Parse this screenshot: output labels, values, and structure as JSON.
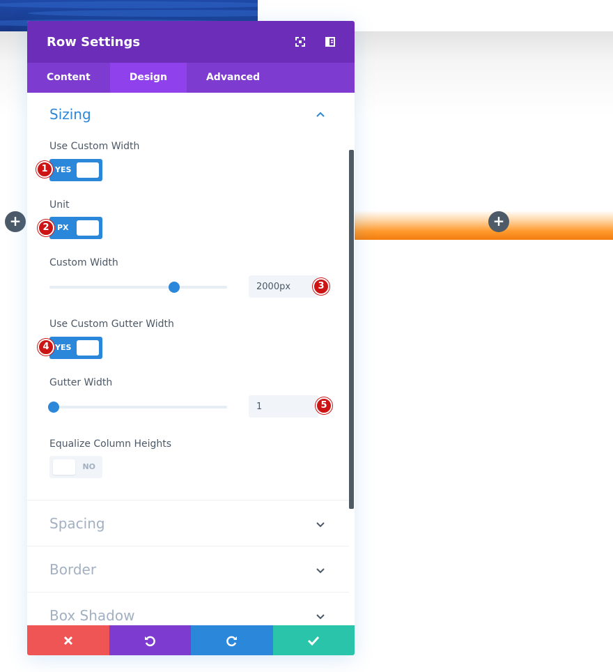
{
  "modal": {
    "title": "Row Settings",
    "header_icons": [
      "expand-icon",
      "sidebar-layout-icon"
    ],
    "tabs": [
      {
        "label": "Content",
        "active": false
      },
      {
        "label": "Design",
        "active": true
      },
      {
        "label": "Advanced",
        "active": false
      }
    ]
  },
  "sizing": {
    "title": "Sizing",
    "use_custom_width": {
      "label": "Use Custom Width",
      "value": "YES"
    },
    "unit": {
      "label": "Unit",
      "value": "PX"
    },
    "custom_width": {
      "label": "Custom Width",
      "value": "2000px",
      "slider_fraction": 0.7
    },
    "use_custom_gutter_width": {
      "label": "Use Custom Gutter Width",
      "value": "YES"
    },
    "gutter_width": {
      "label": "Gutter Width",
      "value": "1",
      "slider_fraction": 0.0
    },
    "equalize_column_heights": {
      "label": "Equalize Column Heights",
      "value": "NO"
    }
  },
  "collapsed_sections": [
    {
      "title": "Spacing"
    },
    {
      "title": "Border"
    },
    {
      "title": "Box Shadow"
    }
  ],
  "markers": [
    "1",
    "2",
    "3",
    "4",
    "5"
  ],
  "footer": {
    "buttons": [
      "close-icon",
      "undo-icon",
      "redo-icon",
      "check-icon"
    ]
  },
  "colors": {
    "header": "#6c2eb9",
    "tabs": "#7e3bd0",
    "active_tab": "#8f42ec",
    "accent": "#2b87da",
    "cancel": "#ef5555",
    "undo": "#7e3bd0",
    "redo": "#2b87da",
    "save": "#29c4a9",
    "marker": "#cc1414"
  }
}
